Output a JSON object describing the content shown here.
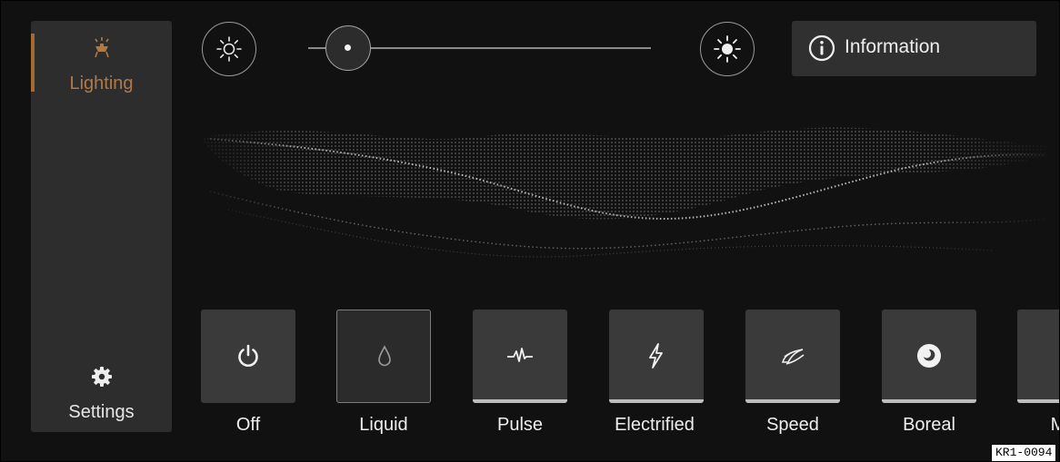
{
  "sidebar": {
    "items": [
      {
        "label": "Lighting",
        "icon": "lamp-icon",
        "active": true
      },
      {
        "label": "Settings",
        "icon": "gear-icon",
        "active": false
      }
    ]
  },
  "brightness": {
    "decrease_icon": "brightness-low-icon",
    "increase_icon": "brightness-high-icon",
    "level": 0.1
  },
  "info_button": {
    "label": "Information",
    "icon": "info-icon"
  },
  "modes": [
    {
      "label": "Off",
      "icon": "power-icon",
      "selected": false
    },
    {
      "label": "Liquid",
      "icon": "droplet-icon",
      "selected": true
    },
    {
      "label": "Pulse",
      "icon": "pulse-icon",
      "selected": false
    },
    {
      "label": "Electrified",
      "icon": "lightning-icon",
      "selected": false
    },
    {
      "label": "Speed",
      "icon": "speed-icon",
      "selected": false
    },
    {
      "label": "Boreal",
      "icon": "boreal-icon",
      "selected": false
    },
    {
      "label": "M",
      "icon": "person-icon",
      "selected": false
    }
  ],
  "reference_code": "KR1-0094",
  "colors": {
    "accent": "#b07a48",
    "background": "#111111",
    "panel": "#2d2d2d"
  }
}
